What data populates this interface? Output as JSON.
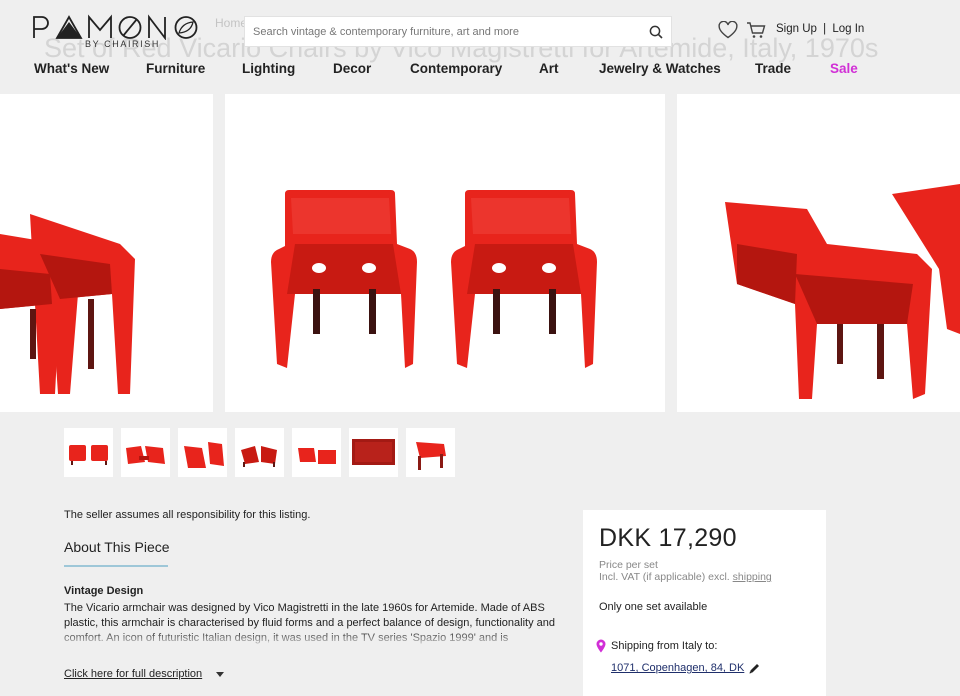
{
  "header": {
    "background_title": "Set of Red Vicario Chairs by Vico Magistretti for Artemide, Italy, 1970s",
    "breadcrumb": "Home",
    "logo_text": "PAMONO",
    "logo_subtitle": "BY CHAIRISH",
    "search_placeholder": "Search vintage & contemporary furniture, art and more",
    "sign_up": "Sign Up",
    "separator": "|",
    "log_in": "Log In",
    "icons": [
      "search-icon",
      "heart-icon",
      "cart-icon"
    ]
  },
  "nav": {
    "items": [
      {
        "label": "What's New"
      },
      {
        "label": "Furniture"
      },
      {
        "label": "Lighting"
      },
      {
        "label": "Decor"
      },
      {
        "label": "Contemporary"
      },
      {
        "label": "Art"
      },
      {
        "label": "Jewelry & Watches"
      },
      {
        "label": "Trade"
      },
      {
        "label": "Sale"
      }
    ],
    "sale_color": "#d12fd6"
  },
  "gallery": {
    "thumbnail_count": 7,
    "chair_color": "#e8241c"
  },
  "listing": {
    "seller_note": "The seller assumes all responsibility for this listing.",
    "about_title": "About This Piece",
    "description_heading": "Vintage Design",
    "description": "The Vicario armchair was designed by Vico Magistretti in the late 1960s for Artemide. Made of ABS plastic, this armchair is characterised by fluid forms and a perfect balance of design, functionality and comfort. An icon of futuristic Italian design, it was used in the TV series 'Spazio 1999' and is",
    "full_description_link": "Click here for full description"
  },
  "price_card": {
    "price": "DKK 17,290",
    "price_unit": "Price per set",
    "vat_prefix": "Incl. VAT (if applicable) excl.",
    "vat_link": "shipping",
    "availability": "Only one set available",
    "shipping_from": "Shipping from Italy to:",
    "shipping_to": "1071, Copenhagen, 84, DK"
  }
}
